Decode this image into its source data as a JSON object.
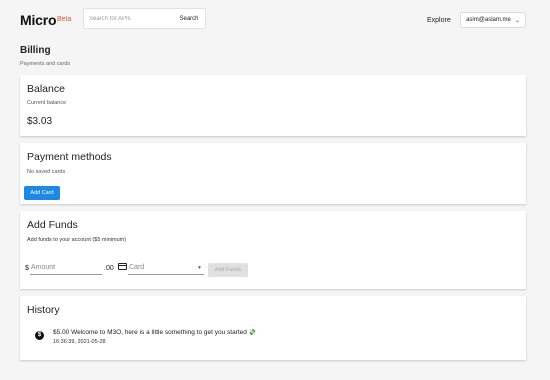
{
  "header": {
    "logo": "Micro",
    "beta": "Beta",
    "search_placeholder": "Search for APIs",
    "search_button": "Search",
    "explore": "Explore",
    "user": "asim@aslam.me"
  },
  "page": {
    "title": "Billing",
    "subtitle": "Payments and cards"
  },
  "balance": {
    "title": "Balance",
    "label": "Current balance",
    "amount": "$3.03"
  },
  "payment_methods": {
    "title": "Payment methods",
    "empty_text": "No saved cards",
    "add_button": "Add Card"
  },
  "add_funds": {
    "title": "Add Funds",
    "description": "Add funds to your account ($5 minimum)",
    "currency_symbol": "$",
    "amount_placeholder": "Amount",
    "cents": ".00",
    "card_placeholder": "Card",
    "submit_button": "Add Funds"
  },
  "history": {
    "title": "History",
    "items": [
      {
        "text": "$5.00 Welcome to M3O, here is a little something to get you started",
        "timestamp": "16:36:39, 2021-05-28"
      }
    ]
  },
  "colors": {
    "accent": "#1e88e5",
    "beta": "#e0542a",
    "background": "#f5f5f5"
  }
}
